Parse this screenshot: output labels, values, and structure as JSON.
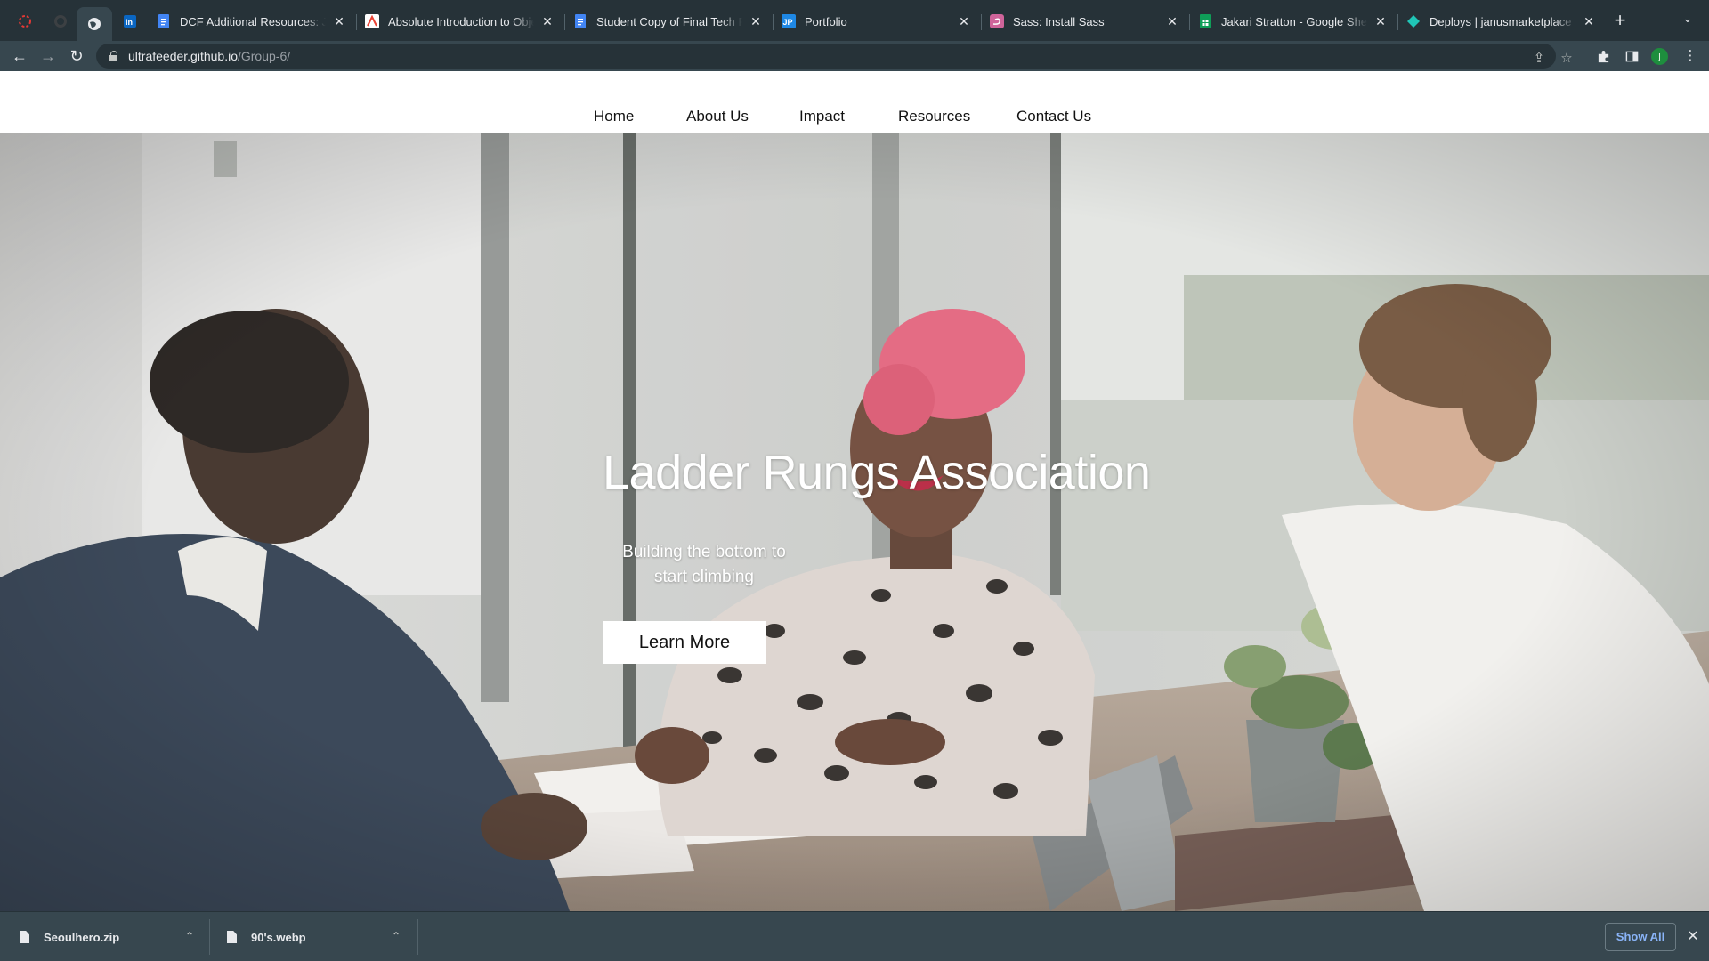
{
  "browser": {
    "pinned_tabs": [
      {
        "icon": "opera-red-icon"
      },
      {
        "icon": "github-icon"
      },
      {
        "icon": "globe-icon"
      },
      {
        "icon": "linkedin-icon"
      }
    ],
    "tabs": [
      {
        "title": "DCF Additional Resources: Ja",
        "icon": "google-docs-icon",
        "color": "#4285f4"
      },
      {
        "title": "Absolute Introduction to Obje",
        "icon": "pdf-icon",
        "color": "#ea4335"
      },
      {
        "title": "Student Copy of Final Tech Pr",
        "icon": "google-docs-icon",
        "color": "#4285f4"
      },
      {
        "title": "Portfolio",
        "icon": "jp-icon",
        "color": "#1e88e5"
      },
      {
        "title": "Sass: Install Sass",
        "icon": "sass-icon",
        "color": "#cf649a"
      },
      {
        "title": "Jakari Stratton - Google Shee",
        "icon": "google-sheets-icon",
        "color": "#0f9d58"
      },
      {
        "title": "Deploys | janusmarketplace",
        "icon": "netlify-icon",
        "color": "#20c6b7"
      }
    ],
    "url_host": "ultrafeeder.github.io",
    "url_path": "/Group-6/",
    "profile_initial": "j"
  },
  "site": {
    "nav": [
      "Home",
      "About Us",
      "Impact",
      "Resources",
      "Contact Us"
    ],
    "hero": {
      "title": "Ladder Rungs Association",
      "subtitle": "Building the bottom to start climbing",
      "button": "Learn More"
    }
  },
  "downloads": {
    "items": [
      {
        "name": "Seoulhero.zip"
      },
      {
        "name": "90's.webp"
      }
    ],
    "show_all": "Show All"
  }
}
